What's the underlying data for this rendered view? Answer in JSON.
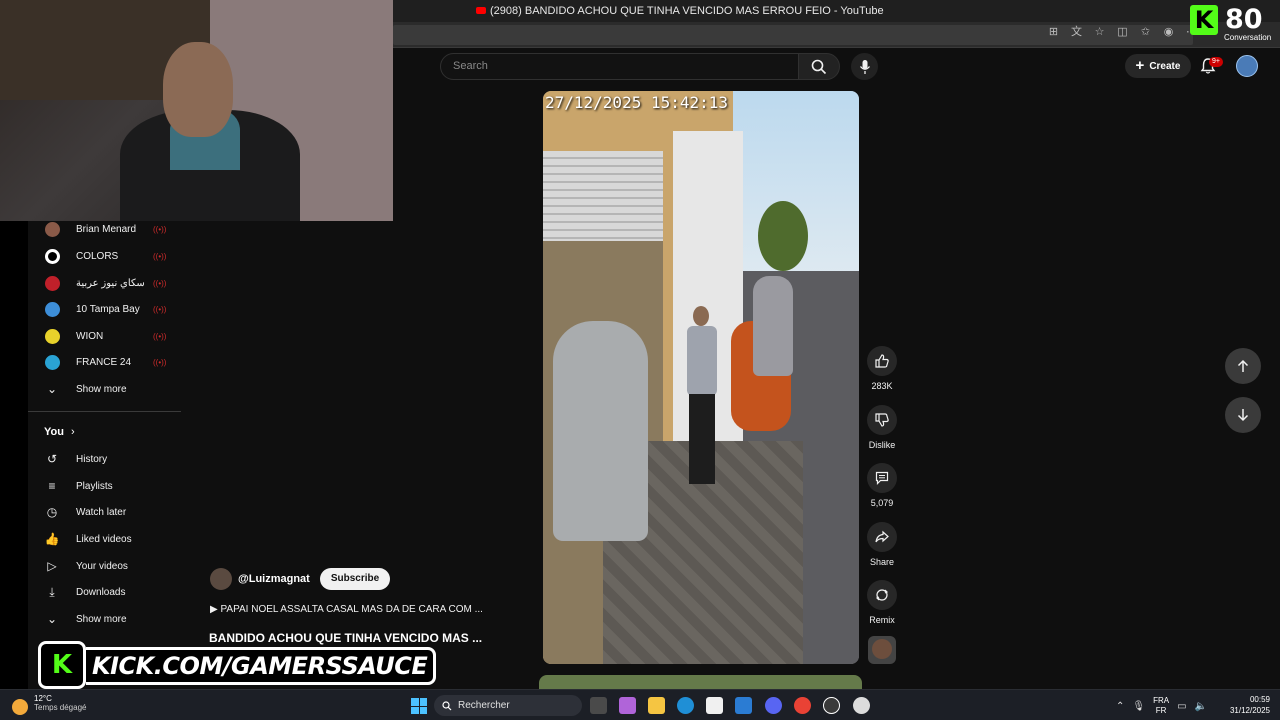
{
  "browser": {
    "tab_title": "(2908) BANDIDO ACHOU QUE TINHA VENCIDO MAS ERROU FEIO - YouTube"
  },
  "header": {
    "search_placeholder": "Search",
    "create_label": "Create",
    "notif_badge": "9+"
  },
  "sidebar": {
    "subscriptions": [
      {
        "label": "Brian Menard",
        "avatar_color": "#8a5a48"
      },
      {
        "label": "COLORS",
        "avatar_color": "#ffffff"
      },
      {
        "label": "سكاي نيوز عربية",
        "avatar_color": "#c0202a"
      },
      {
        "label": "10 Tampa Bay",
        "avatar_color": "#3d8ed8"
      },
      {
        "label": "WION",
        "avatar_color": "#e8d22b"
      },
      {
        "label": "FRANCE 24",
        "avatar_color": "#2aa3d4"
      }
    ],
    "show_more": "Show more",
    "you_section": "You",
    "you_items": [
      {
        "label": "History",
        "icon": "history-icon"
      },
      {
        "label": "Playlists",
        "icon": "playlists-icon"
      },
      {
        "label": "Watch later",
        "icon": "clock-icon"
      },
      {
        "label": "Liked videos",
        "icon": "thumb-up-icon"
      },
      {
        "label": "Your videos",
        "icon": "play-square-icon"
      },
      {
        "label": "Downloads",
        "icon": "download-icon"
      }
    ],
    "show_more_2": "Show more"
  },
  "video": {
    "timestamp": "27/12/2025  15:42:13",
    "channel": "@Luizmagnat",
    "subscribe_label": "Subscribe",
    "playlist": "PAPAI NOEL ASSALTA CASAL MAS DA DE CARA COM ...",
    "title": "BANDIDO ACHOU QUE TINHA VENCIDO MAS ..."
  },
  "actions": {
    "likes": "283K",
    "dislike": "Dislike",
    "comments": "5,079",
    "share": "Share",
    "remix": "Remix"
  },
  "overlay": {
    "kick_url": "KICK.COM/GAMERSSAUCE",
    "viewer_count": "80",
    "viewer_label": "Conversation",
    "kick_green": "#53fc18"
  },
  "taskbar": {
    "temp": "12°C",
    "weather": "Temps dégagé",
    "search": "Rechercher",
    "lang_top": "FRA",
    "lang_bottom": "FR",
    "time": "00:59",
    "date": "31/12/2025"
  }
}
